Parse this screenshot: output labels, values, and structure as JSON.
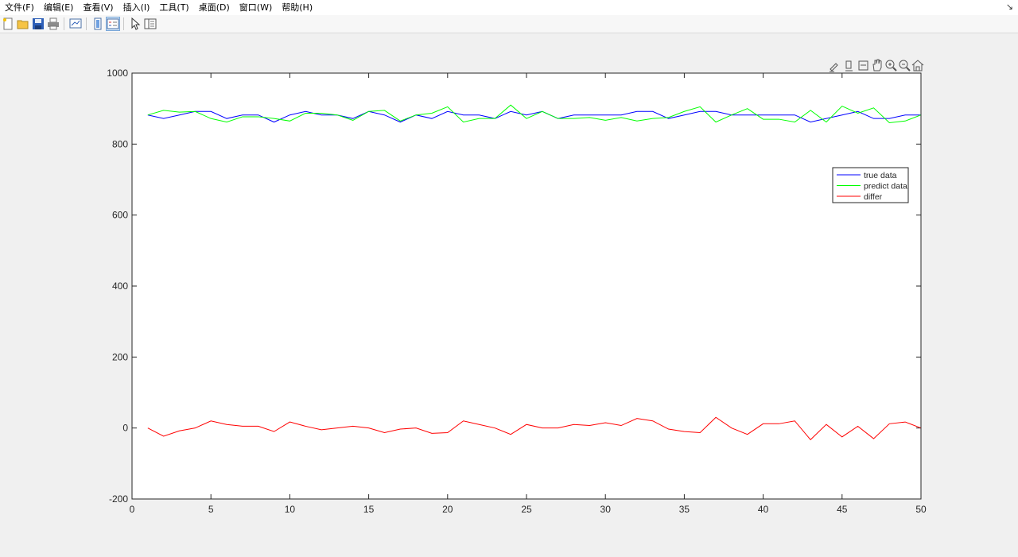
{
  "menu": {
    "items": [
      "文件(F)",
      "编辑(E)",
      "查看(V)",
      "插入(I)",
      "工具(T)",
      "桌面(D)",
      "窗口(W)",
      "帮助(H)"
    ],
    "corner_icon": "pin-arrow-icon"
  },
  "toolbar": {
    "buttons": [
      "new-figure-icon",
      "open-file-icon",
      "save-icon",
      "print-icon",
      "link-plot-icon",
      "insert-colorbar-icon",
      "insert-legend-icon",
      "select-arrow-icon",
      "plot-tools-icon"
    ]
  },
  "axes_toolbar": {
    "buttons": [
      "brush-icon",
      "data-tips-icon",
      "restore-view-icon",
      "pan-icon",
      "zoom-in-icon",
      "zoom-out-icon",
      "home-icon"
    ]
  },
  "chart_data": {
    "type": "line",
    "title": "",
    "xlabel": "",
    "ylabel": "",
    "xlim": [
      0,
      50
    ],
    "ylim": [
      -200,
      1000
    ],
    "xticks": [
      "0",
      "5",
      "10",
      "15",
      "20",
      "25",
      "30",
      "35",
      "40",
      "45",
      "50"
    ],
    "yticks": [
      "-200",
      "0",
      "200",
      "400",
      "600",
      "800",
      "1000"
    ],
    "legend_position": "right, upper",
    "grid": false,
    "x": [
      1,
      2,
      3,
      4,
      5,
      6,
      7,
      8,
      9,
      10,
      11,
      12,
      13,
      14,
      15,
      16,
      17,
      18,
      19,
      20,
      21,
      22,
      23,
      24,
      25,
      26,
      27,
      28,
      29,
      30,
      31,
      32,
      33,
      34,
      35,
      36,
      37,
      38,
      39,
      40,
      41,
      42,
      43,
      44,
      45,
      46,
      47,
      48,
      49,
      50
    ],
    "series": [
      {
        "name": "true data",
        "color": "#0000ff",
        "values": [
          882,
          872,
          882,
          892,
          892,
          872,
          882,
          882,
          862,
          882,
          892,
          882,
          882,
          872,
          892,
          882,
          862,
          882,
          872,
          892,
          882,
          882,
          872,
          892,
          882,
          892,
          872,
          882,
          882,
          882,
          882,
          892,
          892,
          872,
          882,
          892,
          892,
          882,
          882,
          882,
          882,
          882,
          862,
          872,
          882,
          892,
          872,
          872,
          882,
          882
        ]
      },
      {
        "name": "predict data",
        "color": "#00ff00",
        "values": [
          882,
          895,
          890,
          892,
          872,
          862,
          877,
          877,
          872,
          865,
          887,
          887,
          882,
          867,
          892,
          895,
          865,
          882,
          887,
          905,
          862,
          872,
          872,
          910,
          872,
          892,
          872,
          872,
          875,
          867,
          875,
          865,
          872,
          875,
          892,
          905,
          862,
          882,
          900,
          870,
          870,
          862,
          895,
          862,
          907,
          887,
          902,
          860,
          865,
          882
        ]
      },
      {
        "name": "differ",
        "color": "#ff0000",
        "values": [
          0,
          -23,
          -8,
          0,
          20,
          10,
          5,
          5,
          -10,
          17,
          5,
          -5,
          0,
          5,
          0,
          -13,
          -3,
          0,
          -15,
          -13,
          20,
          10,
          0,
          -18,
          10,
          0,
          0,
          10,
          7,
          15,
          7,
          27,
          20,
          -3,
          -10,
          -13,
          30,
          0,
          -18,
          12,
          12,
          20,
          -33,
          10,
          -25,
          5,
          -30,
          12,
          17,
          0
        ]
      }
    ]
  }
}
